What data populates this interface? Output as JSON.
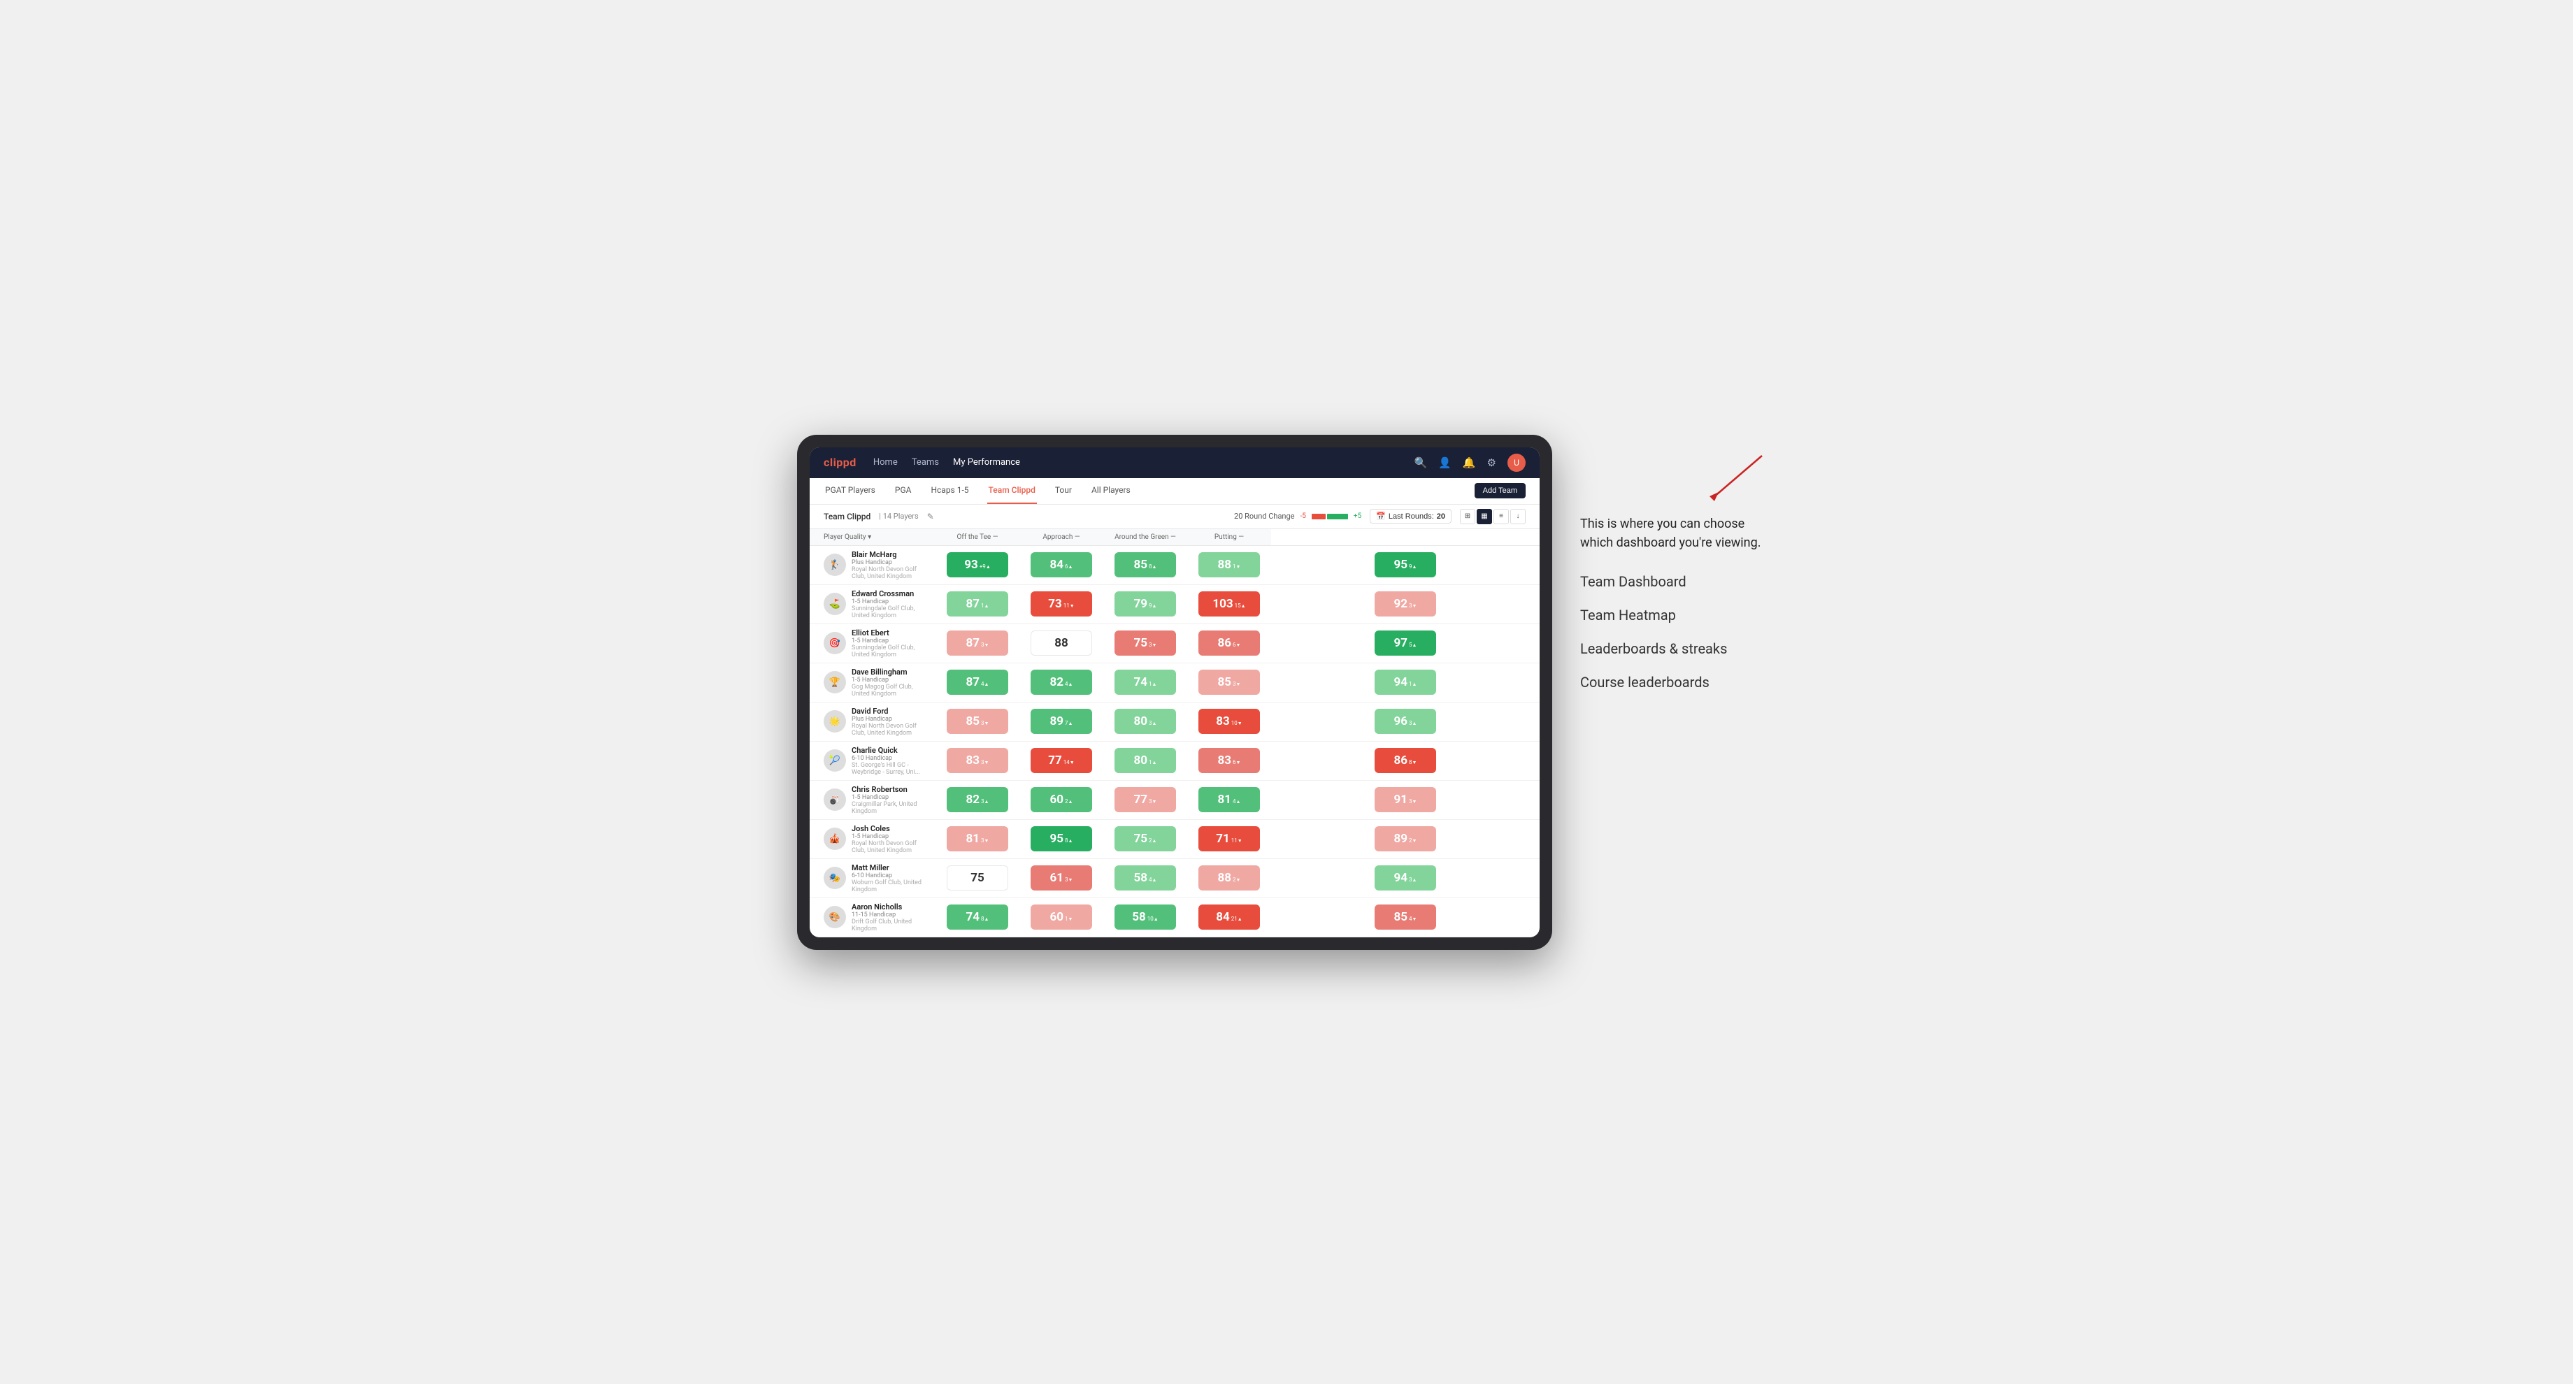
{
  "annotation": {
    "intro": "This is where you can choose which dashboard you're viewing.",
    "items": [
      "Team Dashboard",
      "Team Heatmap",
      "Leaderboards & streaks",
      "Course leaderboards"
    ]
  },
  "nav": {
    "logo": "clippd",
    "links": [
      "Home",
      "Teams",
      "My Performance"
    ],
    "active_link": "My Performance"
  },
  "sub_nav": {
    "links": [
      "PGAT Players",
      "PGA",
      "Hcaps 1-5",
      "Team Clippd",
      "Tour",
      "All Players"
    ],
    "active_link": "Team Clippd",
    "add_team_label": "Add Team"
  },
  "team_header": {
    "title": "Team Clippd",
    "separator": "|",
    "count": "14 Players",
    "round_change_label": "20 Round Change",
    "range_low": "-5",
    "range_high": "+5",
    "last_rounds_label": "Last Rounds:",
    "last_rounds_value": "20"
  },
  "columns": {
    "player_quality": "Player Quality ▾",
    "off_tee": "Off the Tee —",
    "approach": "Approach —",
    "around_green": "Around the Green —",
    "putting": "Putting —"
  },
  "players": [
    {
      "name": "Blair McHarg",
      "hcp": "Plus Handicap",
      "club": "Royal North Devon Golf Club, United Kingdom",
      "scores": {
        "quality": {
          "val": 93,
          "change": "+9",
          "dir": "up",
          "color": "green-dark"
        },
        "off_tee": {
          "val": 84,
          "change": "6",
          "dir": "up",
          "color": "green-med"
        },
        "approach": {
          "val": 85,
          "change": "8",
          "dir": "up",
          "color": "green-med"
        },
        "around": {
          "val": 88,
          "change": "1",
          "dir": "down",
          "color": "green-light"
        },
        "putting": {
          "val": 95,
          "change": "9",
          "dir": "up",
          "color": "green-dark"
        }
      }
    },
    {
      "name": "Edward Crossman",
      "hcp": "1-5 Handicap",
      "club": "Sunningdale Golf Club, United Kingdom",
      "scores": {
        "quality": {
          "val": 87,
          "change": "1",
          "dir": "up",
          "color": "green-light"
        },
        "off_tee": {
          "val": 73,
          "change": "11",
          "dir": "down",
          "color": "red-dark"
        },
        "approach": {
          "val": 79,
          "change": "9",
          "dir": "up",
          "color": "green-light"
        },
        "around": {
          "val": 103,
          "change": "15",
          "dir": "up",
          "color": "red-dark"
        },
        "putting": {
          "val": 92,
          "change": "3",
          "dir": "down",
          "color": "red-light"
        }
      }
    },
    {
      "name": "Elliot Ebert",
      "hcp": "1-5 Handicap",
      "club": "Sunningdale Golf Club, United Kingdom",
      "scores": {
        "quality": {
          "val": 87,
          "change": "3",
          "dir": "down",
          "color": "red-light"
        },
        "off_tee": {
          "val": 88,
          "change": "",
          "dir": "",
          "color": "white-box"
        },
        "approach": {
          "val": 75,
          "change": "3",
          "dir": "down",
          "color": "red-med"
        },
        "around": {
          "val": 86,
          "change": "6",
          "dir": "down",
          "color": "red-med"
        },
        "putting": {
          "val": 97,
          "change": "5",
          "dir": "up",
          "color": "green-dark"
        }
      }
    },
    {
      "name": "Dave Billingham",
      "hcp": "1-5 Handicap",
      "club": "Gog Magog Golf Club, United Kingdom",
      "scores": {
        "quality": {
          "val": 87,
          "change": "4",
          "dir": "up",
          "color": "green-med"
        },
        "off_tee": {
          "val": 82,
          "change": "4",
          "dir": "up",
          "color": "green-med"
        },
        "approach": {
          "val": 74,
          "change": "1",
          "dir": "up",
          "color": "green-light"
        },
        "around": {
          "val": 85,
          "change": "3",
          "dir": "down",
          "color": "red-light"
        },
        "putting": {
          "val": 94,
          "change": "1",
          "dir": "up",
          "color": "green-light"
        }
      }
    },
    {
      "name": "David Ford",
      "hcp": "Plus Handicap",
      "club": "Royal North Devon Golf Club, United Kingdom",
      "scores": {
        "quality": {
          "val": 85,
          "change": "3",
          "dir": "down",
          "color": "red-light"
        },
        "off_tee": {
          "val": 89,
          "change": "7",
          "dir": "up",
          "color": "green-med"
        },
        "approach": {
          "val": 80,
          "change": "3",
          "dir": "up",
          "color": "green-light"
        },
        "around": {
          "val": 83,
          "change": "10",
          "dir": "down",
          "color": "red-dark"
        },
        "putting": {
          "val": 96,
          "change": "3",
          "dir": "up",
          "color": "green-light"
        }
      }
    },
    {
      "name": "Charlie Quick",
      "hcp": "6-10 Handicap",
      "club": "St. George's Hill GC - Weybridge - Surrey, Uni...",
      "scores": {
        "quality": {
          "val": 83,
          "change": "3",
          "dir": "down",
          "color": "red-light"
        },
        "off_tee": {
          "val": 77,
          "change": "14",
          "dir": "down",
          "color": "red-dark"
        },
        "approach": {
          "val": 80,
          "change": "1",
          "dir": "up",
          "color": "green-light"
        },
        "around": {
          "val": 83,
          "change": "6",
          "dir": "down",
          "color": "red-med"
        },
        "putting": {
          "val": 86,
          "change": "8",
          "dir": "down",
          "color": "red-dark"
        }
      }
    },
    {
      "name": "Chris Robertson",
      "hcp": "1-5 Handicap",
      "club": "Craigmillar Park, United Kingdom",
      "scores": {
        "quality": {
          "val": 82,
          "change": "3",
          "dir": "up",
          "color": "green-med"
        },
        "off_tee": {
          "val": 60,
          "change": "2",
          "dir": "up",
          "color": "green-med"
        },
        "approach": {
          "val": 77,
          "change": "3",
          "dir": "down",
          "color": "red-light"
        },
        "around": {
          "val": 81,
          "change": "4",
          "dir": "up",
          "color": "green-med"
        },
        "putting": {
          "val": 91,
          "change": "3",
          "dir": "down",
          "color": "red-light"
        }
      }
    },
    {
      "name": "Josh Coles",
      "hcp": "1-5 Handicap",
      "club": "Royal North Devon Golf Club, United Kingdom",
      "scores": {
        "quality": {
          "val": 81,
          "change": "3",
          "dir": "down",
          "color": "red-light"
        },
        "off_tee": {
          "val": 95,
          "change": "8",
          "dir": "up",
          "color": "green-dark"
        },
        "approach": {
          "val": 75,
          "change": "2",
          "dir": "up",
          "color": "green-light"
        },
        "around": {
          "val": 71,
          "change": "11",
          "dir": "down",
          "color": "red-dark"
        },
        "putting": {
          "val": 89,
          "change": "2",
          "dir": "down",
          "color": "red-light"
        }
      }
    },
    {
      "name": "Matt Miller",
      "hcp": "6-10 Handicap",
      "club": "Woburn Golf Club, United Kingdom",
      "scores": {
        "quality": {
          "val": 75,
          "change": "",
          "dir": "",
          "color": "white-box"
        },
        "off_tee": {
          "val": 61,
          "change": "3",
          "dir": "down",
          "color": "red-med"
        },
        "approach": {
          "val": 58,
          "change": "4",
          "dir": "up",
          "color": "green-light"
        },
        "around": {
          "val": 88,
          "change": "2",
          "dir": "down",
          "color": "red-light"
        },
        "putting": {
          "val": 94,
          "change": "3",
          "dir": "up",
          "color": "green-light"
        }
      }
    },
    {
      "name": "Aaron Nicholls",
      "hcp": "11-15 Handicap",
      "club": "Drift Golf Club, United Kingdom",
      "scores": {
        "quality": {
          "val": 74,
          "change": "8",
          "dir": "up",
          "color": "green-med"
        },
        "off_tee": {
          "val": 60,
          "change": "1",
          "dir": "down",
          "color": "red-light"
        },
        "approach": {
          "val": 58,
          "change": "10",
          "dir": "up",
          "color": "green-med"
        },
        "around": {
          "val": 84,
          "change": "21",
          "dir": "up",
          "color": "red-dark"
        },
        "putting": {
          "val": 85,
          "change": "4",
          "dir": "down",
          "color": "red-med"
        }
      }
    }
  ]
}
